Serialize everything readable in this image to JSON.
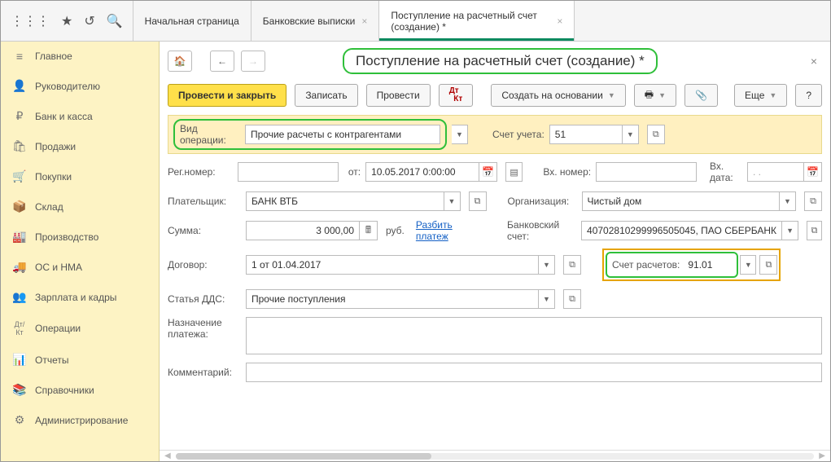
{
  "topbar": {
    "icons": [
      "apps-icon",
      "star-icon",
      "history-icon",
      "search-icon"
    ]
  },
  "tabs": [
    {
      "label": "Начальная страница",
      "closable": false,
      "active": false
    },
    {
      "label": "Банковские выписки",
      "closable": true,
      "active": false
    },
    {
      "label": "Поступление на расчетный счет (создание) *",
      "closable": true,
      "active": true
    }
  ],
  "sidebar": [
    {
      "icon": "≡",
      "label": "Главное"
    },
    {
      "icon": "👤",
      "label": "Руководителю"
    },
    {
      "icon": "₽",
      "label": "Банк и касса"
    },
    {
      "icon": "🛍",
      "label": "Продажи"
    },
    {
      "icon": "🛒",
      "label": "Покупки"
    },
    {
      "icon": "📦",
      "label": "Склад"
    },
    {
      "icon": "🏭",
      "label": "Производство"
    },
    {
      "icon": "🚚",
      "label": "ОС и НМА"
    },
    {
      "icon": "👥",
      "label": "Зарплата и кадры"
    },
    {
      "icon": "Дт/Кт",
      "label": "Операции"
    },
    {
      "icon": "📊",
      "label": "Отчеты"
    },
    {
      "icon": "📚",
      "label": "Справочники"
    },
    {
      "icon": "⚙",
      "label": "Администрирование"
    }
  ],
  "header": {
    "title": "Поступление на расчетный счет (создание) *"
  },
  "toolbar": {
    "post_close": "Провести и закрыть",
    "write": "Записать",
    "post": "Провести",
    "dtkt": "Дт\nКт",
    "create_based": "Создать на основании",
    "more": "Еще"
  },
  "form": {
    "op_type_label": "Вид операции:",
    "op_type_value": "Прочие расчеты с контрагентами",
    "account_label": "Счет учета:",
    "account_value": "51",
    "reg_no_label": "Рег.номер:",
    "reg_no_value": "",
    "from_label": "от:",
    "date_value": "10.05.2017  0:00:00",
    "in_no_label": "Вх. номер:",
    "in_no_value": "",
    "in_date_label": "Вх. дата:",
    "in_date_value": ".   .",
    "payer_label": "Плательщик:",
    "payer_value": "БАНК ВТБ",
    "org_label": "Организация:",
    "org_value": "Чистый дом",
    "sum_label": "Сумма:",
    "sum_value": "3 000,00",
    "currency": "руб.",
    "split_link": "Разбить платеж",
    "bank_acc_label": "Банковский счет:",
    "bank_acc_value": "40702810299996505045, ПАО СБЕРБАНК",
    "contract_label": "Договор:",
    "contract_value": "1 от 01.04.2017",
    "settle_acc_label": "Счет расчетов:",
    "settle_acc_value": "91.01",
    "dds_label": "Статья ДДС:",
    "dds_value": "Прочие поступления",
    "purpose_label": "Назначение платежа:",
    "comment_label": "Комментарий:"
  }
}
